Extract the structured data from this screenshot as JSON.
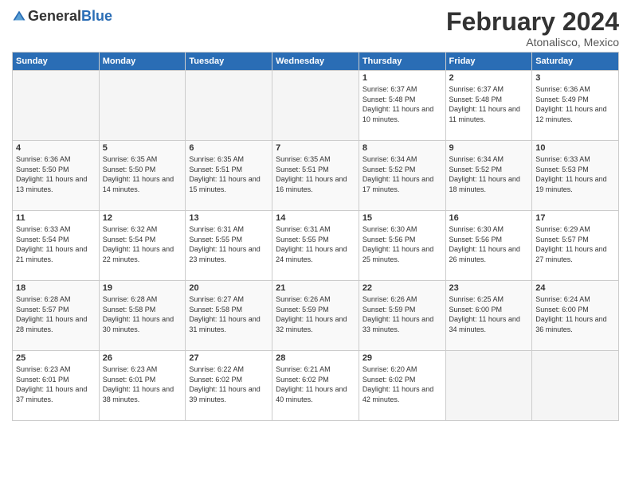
{
  "header": {
    "logo_general": "General",
    "logo_blue": "Blue",
    "month_year": "February 2024",
    "location": "Atonalisco, Mexico"
  },
  "days_of_week": [
    "Sunday",
    "Monday",
    "Tuesday",
    "Wednesday",
    "Thursday",
    "Friday",
    "Saturday"
  ],
  "weeks": [
    [
      {
        "day": "",
        "sunrise": "",
        "sunset": "",
        "daylight": "",
        "empty": true
      },
      {
        "day": "",
        "sunrise": "",
        "sunset": "",
        "daylight": "",
        "empty": true
      },
      {
        "day": "",
        "sunrise": "",
        "sunset": "",
        "daylight": "",
        "empty": true
      },
      {
        "day": "",
        "sunrise": "",
        "sunset": "",
        "daylight": "",
        "empty": true
      },
      {
        "day": "1",
        "sunrise": "Sunrise: 6:37 AM",
        "sunset": "Sunset: 5:48 PM",
        "daylight": "Daylight: 11 hours and 10 minutes."
      },
      {
        "day": "2",
        "sunrise": "Sunrise: 6:37 AM",
        "sunset": "Sunset: 5:48 PM",
        "daylight": "Daylight: 11 hours and 11 minutes."
      },
      {
        "day": "3",
        "sunrise": "Sunrise: 6:36 AM",
        "sunset": "Sunset: 5:49 PM",
        "daylight": "Daylight: 11 hours and 12 minutes."
      }
    ],
    [
      {
        "day": "4",
        "sunrise": "Sunrise: 6:36 AM",
        "sunset": "Sunset: 5:50 PM",
        "daylight": "Daylight: 11 hours and 13 minutes."
      },
      {
        "day": "5",
        "sunrise": "Sunrise: 6:35 AM",
        "sunset": "Sunset: 5:50 PM",
        "daylight": "Daylight: 11 hours and 14 minutes."
      },
      {
        "day": "6",
        "sunrise": "Sunrise: 6:35 AM",
        "sunset": "Sunset: 5:51 PM",
        "daylight": "Daylight: 11 hours and 15 minutes."
      },
      {
        "day": "7",
        "sunrise": "Sunrise: 6:35 AM",
        "sunset": "Sunset: 5:51 PM",
        "daylight": "Daylight: 11 hours and 16 minutes."
      },
      {
        "day": "8",
        "sunrise": "Sunrise: 6:34 AM",
        "sunset": "Sunset: 5:52 PM",
        "daylight": "Daylight: 11 hours and 17 minutes."
      },
      {
        "day": "9",
        "sunrise": "Sunrise: 6:34 AM",
        "sunset": "Sunset: 5:52 PM",
        "daylight": "Daylight: 11 hours and 18 minutes."
      },
      {
        "day": "10",
        "sunrise": "Sunrise: 6:33 AM",
        "sunset": "Sunset: 5:53 PM",
        "daylight": "Daylight: 11 hours and 19 minutes."
      }
    ],
    [
      {
        "day": "11",
        "sunrise": "Sunrise: 6:33 AM",
        "sunset": "Sunset: 5:54 PM",
        "daylight": "Daylight: 11 hours and 21 minutes."
      },
      {
        "day": "12",
        "sunrise": "Sunrise: 6:32 AM",
        "sunset": "Sunset: 5:54 PM",
        "daylight": "Daylight: 11 hours and 22 minutes."
      },
      {
        "day": "13",
        "sunrise": "Sunrise: 6:31 AM",
        "sunset": "Sunset: 5:55 PM",
        "daylight": "Daylight: 11 hours and 23 minutes."
      },
      {
        "day": "14",
        "sunrise": "Sunrise: 6:31 AM",
        "sunset": "Sunset: 5:55 PM",
        "daylight": "Daylight: 11 hours and 24 minutes."
      },
      {
        "day": "15",
        "sunrise": "Sunrise: 6:30 AM",
        "sunset": "Sunset: 5:56 PM",
        "daylight": "Daylight: 11 hours and 25 minutes."
      },
      {
        "day": "16",
        "sunrise": "Sunrise: 6:30 AM",
        "sunset": "Sunset: 5:56 PM",
        "daylight": "Daylight: 11 hours and 26 minutes."
      },
      {
        "day": "17",
        "sunrise": "Sunrise: 6:29 AM",
        "sunset": "Sunset: 5:57 PM",
        "daylight": "Daylight: 11 hours and 27 minutes."
      }
    ],
    [
      {
        "day": "18",
        "sunrise": "Sunrise: 6:28 AM",
        "sunset": "Sunset: 5:57 PM",
        "daylight": "Daylight: 11 hours and 28 minutes."
      },
      {
        "day": "19",
        "sunrise": "Sunrise: 6:28 AM",
        "sunset": "Sunset: 5:58 PM",
        "daylight": "Daylight: 11 hours and 30 minutes."
      },
      {
        "day": "20",
        "sunrise": "Sunrise: 6:27 AM",
        "sunset": "Sunset: 5:58 PM",
        "daylight": "Daylight: 11 hours and 31 minutes."
      },
      {
        "day": "21",
        "sunrise": "Sunrise: 6:26 AM",
        "sunset": "Sunset: 5:59 PM",
        "daylight": "Daylight: 11 hours and 32 minutes."
      },
      {
        "day": "22",
        "sunrise": "Sunrise: 6:26 AM",
        "sunset": "Sunset: 5:59 PM",
        "daylight": "Daylight: 11 hours and 33 minutes."
      },
      {
        "day": "23",
        "sunrise": "Sunrise: 6:25 AM",
        "sunset": "Sunset: 6:00 PM",
        "daylight": "Daylight: 11 hours and 34 minutes."
      },
      {
        "day": "24",
        "sunrise": "Sunrise: 6:24 AM",
        "sunset": "Sunset: 6:00 PM",
        "daylight": "Daylight: 11 hours and 36 minutes."
      }
    ],
    [
      {
        "day": "25",
        "sunrise": "Sunrise: 6:23 AM",
        "sunset": "Sunset: 6:01 PM",
        "daylight": "Daylight: 11 hours and 37 minutes."
      },
      {
        "day": "26",
        "sunrise": "Sunrise: 6:23 AM",
        "sunset": "Sunset: 6:01 PM",
        "daylight": "Daylight: 11 hours and 38 minutes."
      },
      {
        "day": "27",
        "sunrise": "Sunrise: 6:22 AM",
        "sunset": "Sunset: 6:02 PM",
        "daylight": "Daylight: 11 hours and 39 minutes."
      },
      {
        "day": "28",
        "sunrise": "Sunrise: 6:21 AM",
        "sunset": "Sunset: 6:02 PM",
        "daylight": "Daylight: 11 hours and 40 minutes."
      },
      {
        "day": "29",
        "sunrise": "Sunrise: 6:20 AM",
        "sunset": "Sunset: 6:02 PM",
        "daylight": "Daylight: 11 hours and 42 minutes."
      },
      {
        "day": "",
        "sunrise": "",
        "sunset": "",
        "daylight": "",
        "empty": true
      },
      {
        "day": "",
        "sunrise": "",
        "sunset": "",
        "daylight": "",
        "empty": true
      }
    ]
  ]
}
